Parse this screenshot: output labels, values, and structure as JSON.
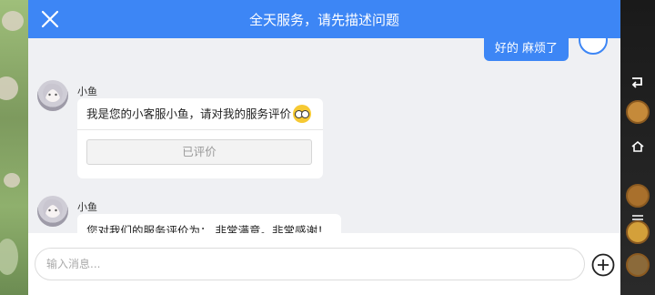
{
  "header": {
    "title": "全天服务，请先描述问题"
  },
  "own_message": {
    "text": "好的 麻烦了"
  },
  "messages": [
    {
      "sender": "小鱼",
      "text": "我是您的小客服小鱼，请对我的服务评价",
      "button_label": "已评价"
    },
    {
      "sender": "小鱼",
      "text": "您对我们的服务评价为： 非常满意。非常感谢！"
    }
  ],
  "input": {
    "placeholder": "输入消息..."
  },
  "colors": {
    "accent": "#3d86f5",
    "panel_bg": "#eff0f3"
  }
}
